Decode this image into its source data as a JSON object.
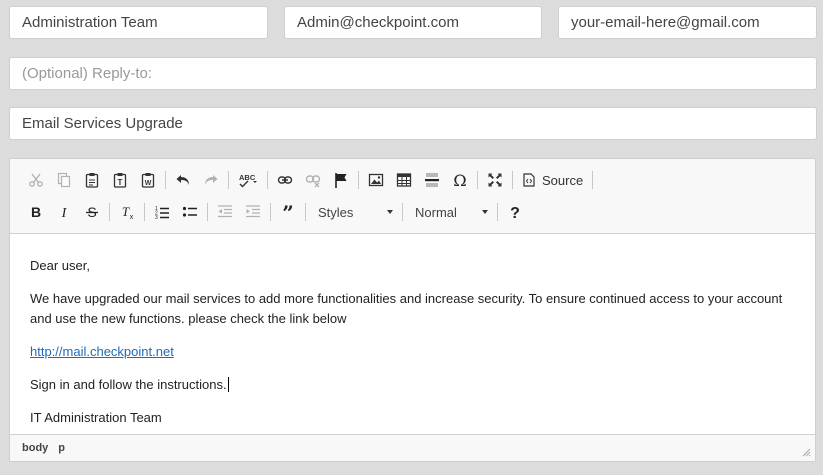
{
  "fields": {
    "from_name": "Administration Team",
    "from_email": "Admin@checkpoint.com",
    "to_email": "your-email-here@gmail.com",
    "reply_to_placeholder": "(Optional) Reply-to:",
    "subject": "Email Services Upgrade"
  },
  "toolbar": {
    "source_label": "Source",
    "styles_label": "Styles",
    "format_label": "Normal",
    "row1_icons": [
      "cut-icon",
      "copy-icon",
      "paste-icon",
      "paste-text-icon",
      "paste-word-icon",
      "undo-icon",
      "redo-icon",
      "spellcheck-icon",
      "link-icon",
      "unlink-icon",
      "anchor-icon",
      "image-icon",
      "table-icon",
      "horizontal-line-icon",
      "special-char-icon",
      "maximize-icon",
      "source-icon"
    ],
    "row2_icons": [
      "bold-icon",
      "italic-icon",
      "strikethrough-icon",
      "remove-format-icon",
      "numbered-list-icon",
      "bulleted-list-icon",
      "outdent-icon",
      "indent-icon",
      "blockquote-icon",
      "help-icon"
    ]
  },
  "body": {
    "greeting": "Dear user,",
    "paragraph": "We have upgraded our mail services to add more functionalities and increase security. To ensure continued access to your account and use the new functions. please check the link below",
    "link": "http://mail.checkpoint.net",
    "instruction": "Sign in and follow the instructions.",
    "signature": "IT Administration Team"
  },
  "statusbar": {
    "path": [
      "body",
      "p"
    ]
  }
}
